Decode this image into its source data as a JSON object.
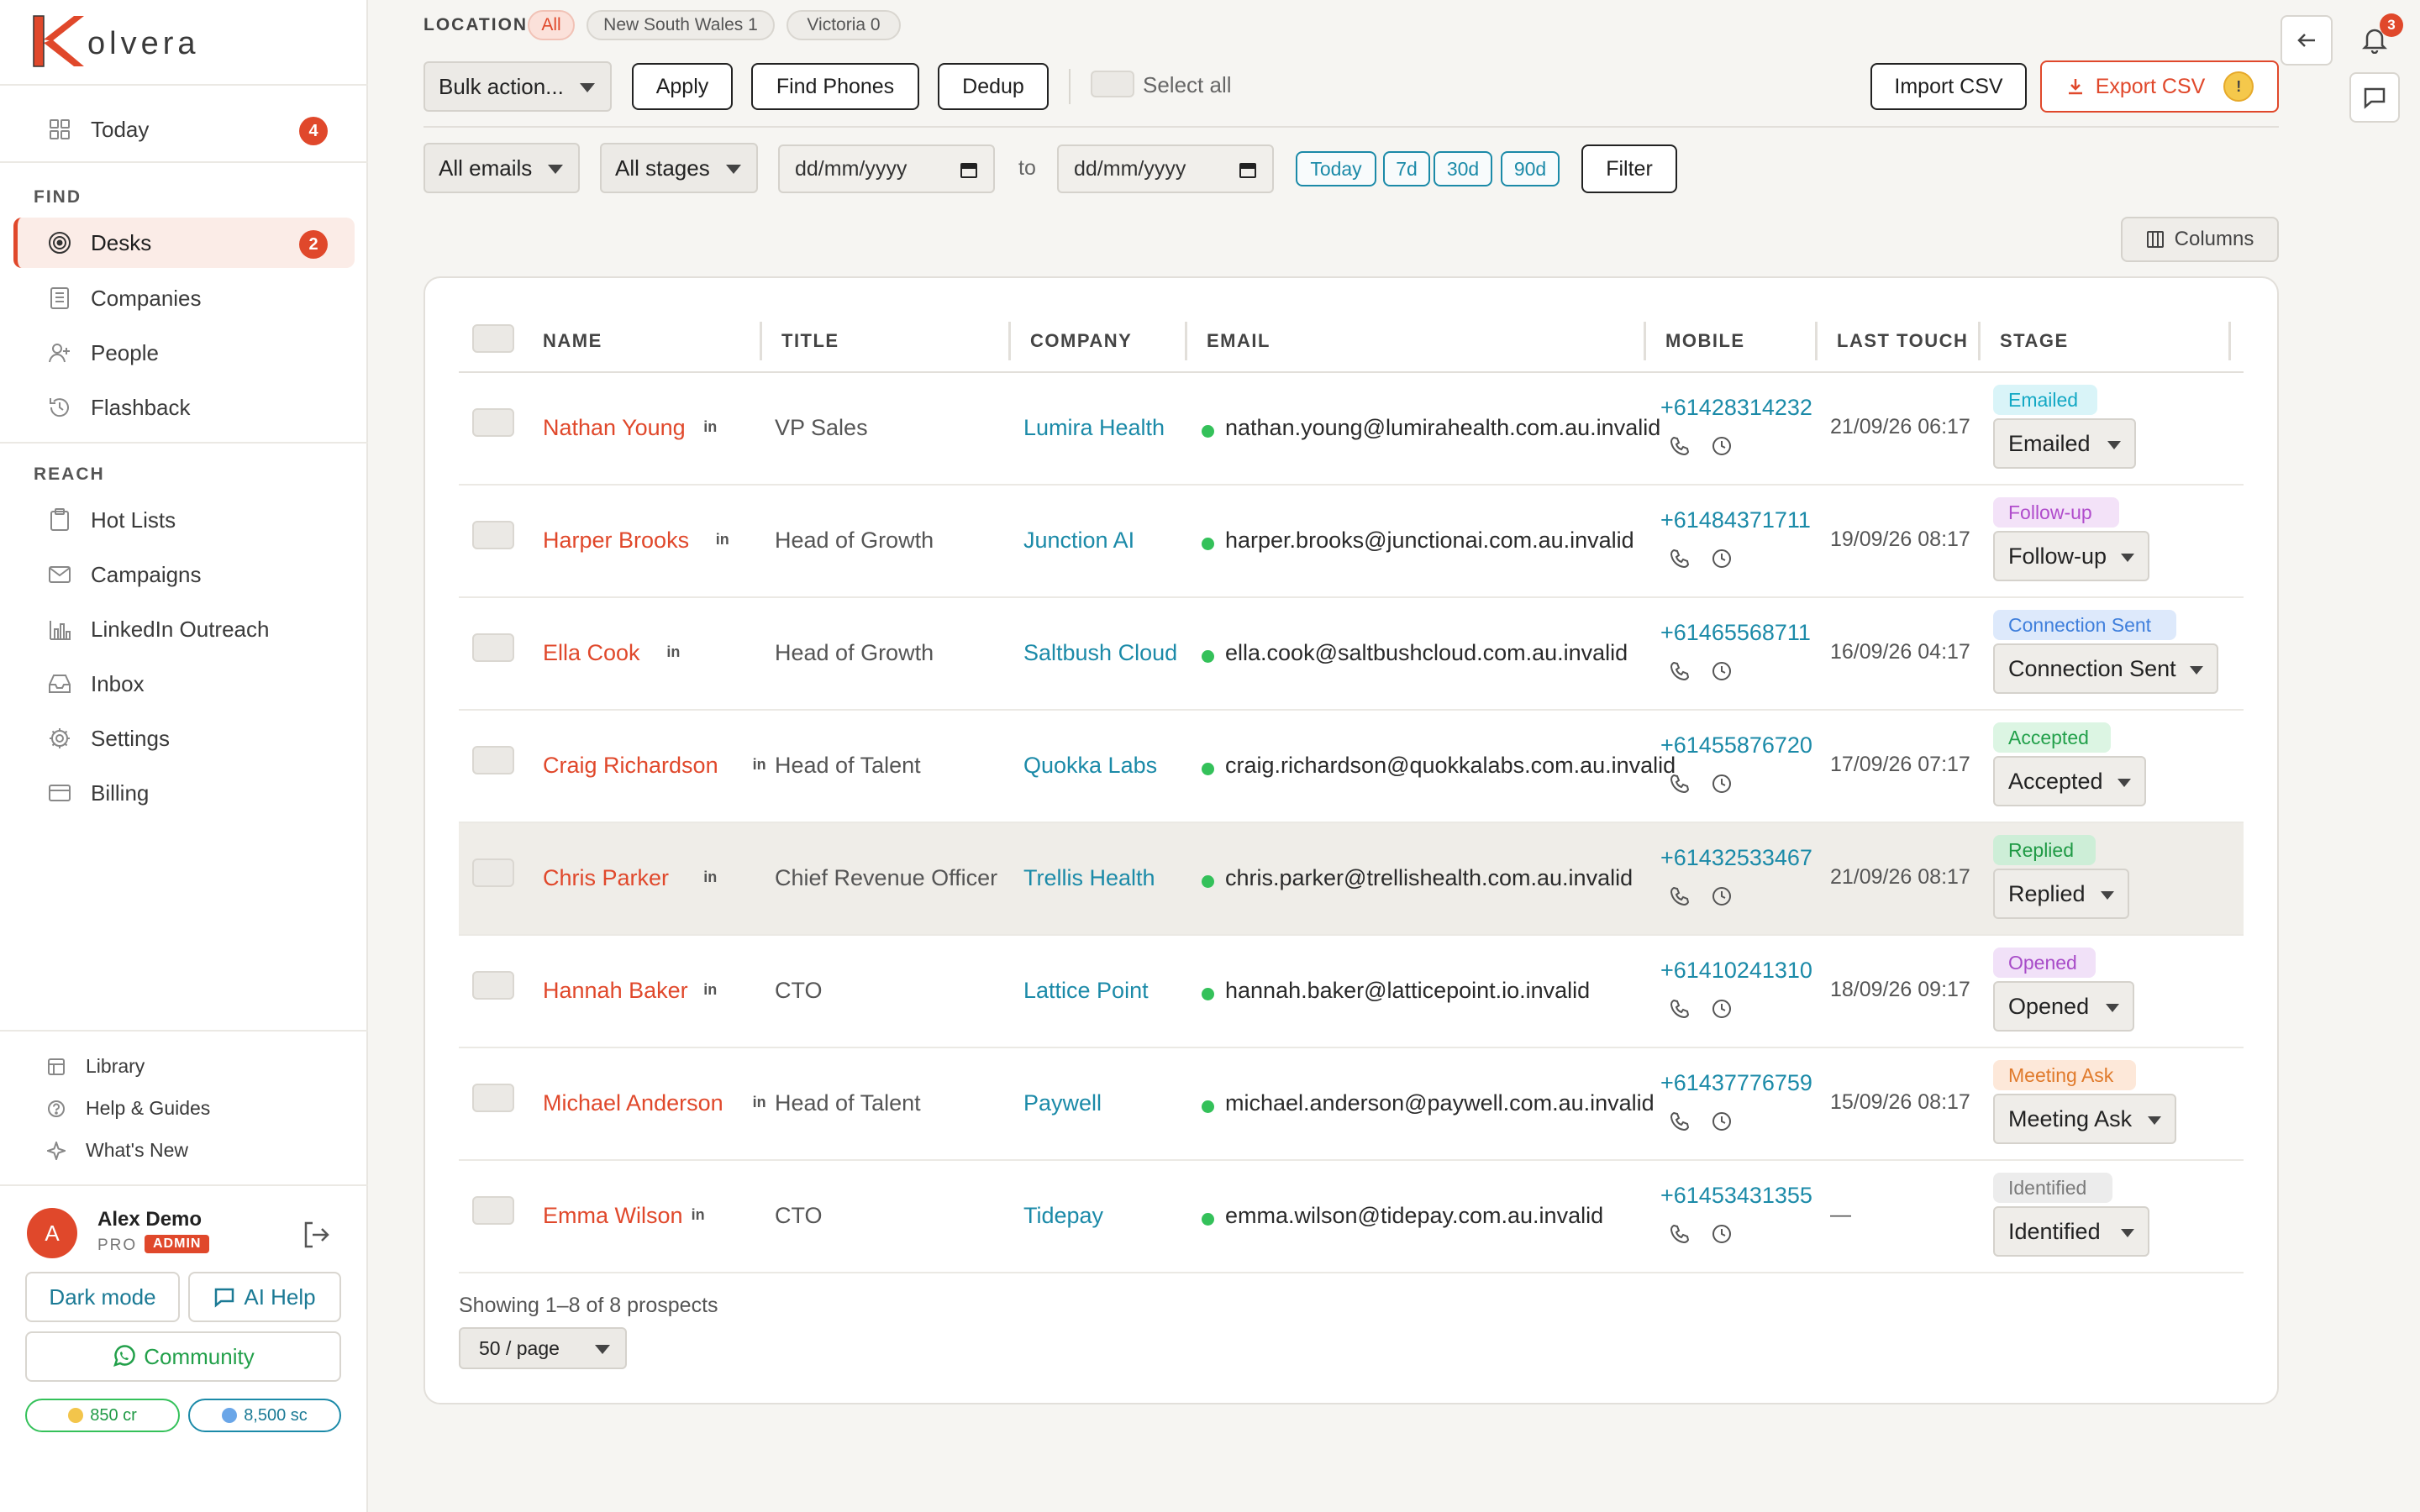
{
  "brand": {
    "logo_text": "olvera",
    "accent": "#e0482b",
    "link": "#1b8aa8"
  },
  "sidebar": {
    "today": {
      "label": "Today",
      "badge": "4"
    },
    "find_label": "FIND",
    "find_items": [
      {
        "label": "Desks",
        "badge": "2",
        "icon": "target-icon"
      },
      {
        "label": "Companies",
        "icon": "building-icon"
      },
      {
        "label": "People",
        "icon": "person-add-icon"
      },
      {
        "label": "Flashback",
        "icon": "history-icon"
      }
    ],
    "reach_label": "REACH",
    "reach_items": [
      {
        "label": "Hot Lists",
        "icon": "clipboard-icon"
      },
      {
        "label": "Campaigns",
        "icon": "mail-icon"
      },
      {
        "label": "LinkedIn Outreach",
        "icon": "bar-chart-icon"
      },
      {
        "label": "Inbox",
        "icon": "inbox-icon"
      },
      {
        "label": "Settings",
        "icon": "gear-icon"
      },
      {
        "label": "Billing",
        "icon": "card-icon"
      }
    ],
    "footer_items": [
      {
        "label": "Library",
        "icon": "library-icon"
      },
      {
        "label": "Help & Guides",
        "icon": "help-icon"
      },
      {
        "label": "What's New",
        "icon": "sparkle-icon"
      }
    ],
    "user": {
      "initial": "A",
      "name": "Alex Demo",
      "plan": "PRO",
      "role": "ADMIN"
    },
    "dark_mode": "Dark mode",
    "ai_help": "AI Help",
    "community": "Community",
    "credits": "850 cr",
    "sc": "8,500 sc"
  },
  "filters": {
    "location_label": "LOCATION",
    "location_chips": [
      {
        "label": "All"
      },
      {
        "label": "New South Wales 1"
      },
      {
        "label": "Victoria 0"
      }
    ],
    "bulk_action": "Bulk action...",
    "apply": "Apply",
    "find_phones": "Find Phones",
    "dedup": "Dedup",
    "select_all": "Select all",
    "import_csv": "Import CSV",
    "export_csv": "Export CSV",
    "export_badge": "!",
    "all_emails": "All emails",
    "all_stages": "All stages",
    "date_from": "dd/mm/yyyy",
    "to": "to",
    "date_to": "dd/mm/yyyy",
    "quick": [
      "Today",
      "7d",
      "30d",
      "90d"
    ],
    "filter": "Filter",
    "columns": "Columns",
    "notification_count": "3"
  },
  "table": {
    "headers": [
      "NAME",
      "TITLE",
      "COMPANY",
      "EMAIL",
      "MOBILE",
      "LAST TOUCH",
      "STAGE"
    ],
    "rows": [
      {
        "name": "Nathan Young",
        "title": "VP Sales",
        "company": "Lumira Health",
        "email": "nathan.young@lumirahealth.com.au.invalid",
        "mobile": "+61428314232",
        "last_touch": "21/09/26 06:17",
        "stage": "Emailed",
        "tag_bg": "#d9f4f8",
        "tag_fg": "#13a8c4"
      },
      {
        "name": "Harper Brooks",
        "title": "Head of Growth",
        "company": "Junction AI",
        "email": "harper.brooks@junctionai.com.au.invalid",
        "mobile": "+61484371711",
        "last_touch": "19/09/26 08:17",
        "stage": "Follow-up",
        "tag_bg": "#f3e2f8",
        "tag_fg": "#b04ccc"
      },
      {
        "name": "Ella Cook",
        "title": "Head of Growth",
        "company": "Saltbush Cloud",
        "email": "ella.cook@saltbushcloud.com.au.invalid",
        "mobile": "+61465568711",
        "last_touch": "16/09/26 04:17",
        "stage": "Connection Sent",
        "tag_bg": "#dde9fb",
        "tag_fg": "#3f7fdc"
      },
      {
        "name": "Craig Richardson",
        "title": "Head of Talent",
        "company": "Quokka Labs",
        "email": "craig.richardson@quokkalabs.com.au.invalid",
        "mobile": "+61455876720",
        "last_touch": "17/09/26 07:17",
        "stage": "Accepted",
        "tag_bg": "#dcf5e3",
        "tag_fg": "#22a04a"
      },
      {
        "name": "Chris Parker",
        "title": "Chief Revenue Officer",
        "company": "Trellis Health",
        "email": "chris.parker@trellishealth.com.au.invalid",
        "mobile": "+61432533467",
        "last_touch": "21/09/26 08:17",
        "stage": "Replied",
        "tag_bg": "#cdeed7",
        "tag_fg": "#1f9a45"
      },
      {
        "name": "Hannah Baker",
        "title": "CTO",
        "company": "Lattice Point",
        "email": "hannah.baker@latticepoint.io.invalid",
        "mobile": "+61410241310",
        "last_touch": "18/09/26 09:17",
        "stage": "Opened",
        "tag_bg": "#f1e1f8",
        "tag_fg": "#a84cc8"
      },
      {
        "name": "Michael Anderson",
        "title": "Head of Talent",
        "company": "Paywell",
        "email": "michael.anderson@paywell.com.au.invalid",
        "mobile": "+61437776759",
        "last_touch": "15/09/26 08:17",
        "stage": "Meeting Ask",
        "tag_bg": "#fde8d9",
        "tag_fg": "#e07a2b"
      },
      {
        "name": "Emma Wilson",
        "title": "CTO",
        "company": "Tidepay",
        "email": "emma.wilson@tidepay.com.au.invalid",
        "mobile": "+61453431355",
        "last_touch": "—",
        "stage": "Identified",
        "tag_bg": "#ececec",
        "tag_fg": "#7a7a7a"
      }
    ],
    "showing": "Showing 1–8 of 8 prospects",
    "page_size": "50 / page"
  }
}
